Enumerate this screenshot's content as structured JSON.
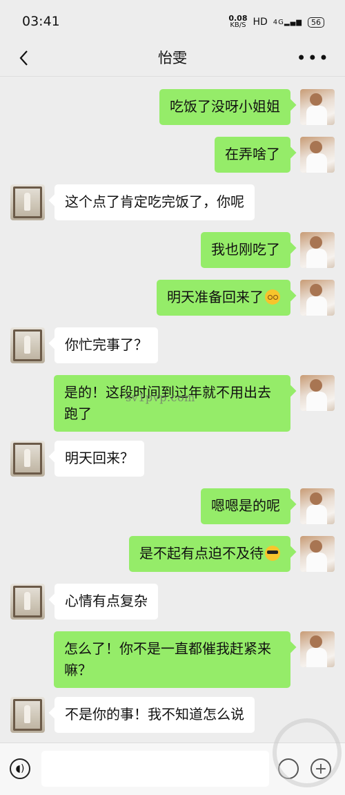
{
  "status_bar": {
    "time": "03:41",
    "net_speed_value": "0.08",
    "net_speed_unit": "KB/S",
    "hd_label": "HD",
    "signal_label": "4G",
    "battery_level": "56"
  },
  "nav": {
    "title": "怡雯",
    "more_label": "•••"
  },
  "messages": [
    {
      "sender": "self",
      "text": "吃饭了没呀小姐姐"
    },
    {
      "sender": "self",
      "text": "在弄啥了"
    },
    {
      "sender": "other",
      "text": "这个点了肯定吃完饭了，你呢"
    },
    {
      "sender": "self",
      "text": "我也刚吃了"
    },
    {
      "sender": "self",
      "text": "明天准备回来了",
      "emoji": "squint-face-icon"
    },
    {
      "sender": "other",
      "text": "你忙完事了？"
    },
    {
      "sender": "self",
      "text": "是的！这段时间到过年就不用出去跑了"
    },
    {
      "sender": "other",
      "text": "明天回来？"
    },
    {
      "sender": "self",
      "text": "嗯嗯是的呢"
    },
    {
      "sender": "self",
      "text": "是不起有点迫不及待",
      "emoji": "sunglasses-face-icon"
    },
    {
      "sender": "other",
      "text": "心情有点复杂"
    },
    {
      "sender": "self",
      "text": "怎么了！你不是一直都催我赶紧来嘛？"
    },
    {
      "sender": "other",
      "text": "不是你的事！我不知道怎么说"
    }
  ],
  "watermark": "sv1pvp.com",
  "input_bar": {
    "input_value": "",
    "voice_icon": "voice-icon",
    "emoji_icon": "emoji-icon",
    "plus_icon": "plus-icon"
  }
}
